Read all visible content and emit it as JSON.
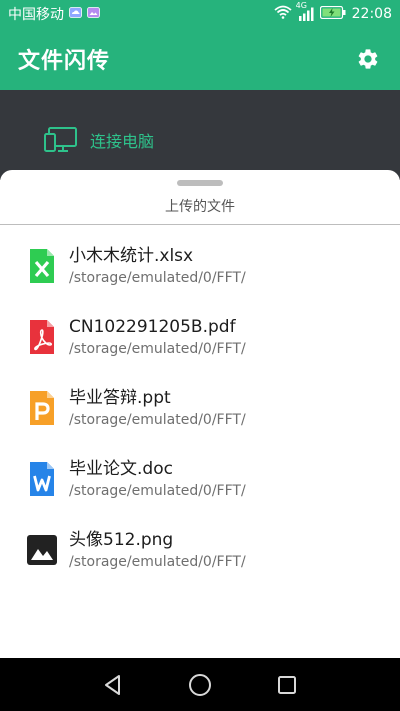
{
  "status": {
    "carrier": "中国移动",
    "network": "4G",
    "time": "22:08"
  },
  "app": {
    "title": "文件闪传",
    "connect_label": "连接电脑"
  },
  "sheet": {
    "title": "上传的文件"
  },
  "files": [
    {
      "name": "小木木统计.xlsx",
      "path": "/storage/emulated/0/FFT/",
      "icon": "excel-file-icon",
      "color": "#2ecc52"
    },
    {
      "name": "CN102291205B.pdf",
      "path": "/storage/emulated/0/FFT/",
      "icon": "pdf-file-icon",
      "color": "#e8323c"
    },
    {
      "name": "毕业答辩.ppt",
      "path": "/storage/emulated/0/FFT/",
      "icon": "ppt-file-icon",
      "color": "#f7a028"
    },
    {
      "name": "毕业论文.doc",
      "path": "/storage/emulated/0/FFT/",
      "icon": "word-file-icon",
      "color": "#2684e8"
    },
    {
      "name": "头像512.png",
      "path": "/storage/emulated/0/FFT/",
      "icon": "image-file-icon",
      "color": "#222222"
    }
  ],
  "colors": {
    "accent": "#26b37c",
    "dark_panel": "#35383d",
    "connect_text": "#2ec28b"
  }
}
